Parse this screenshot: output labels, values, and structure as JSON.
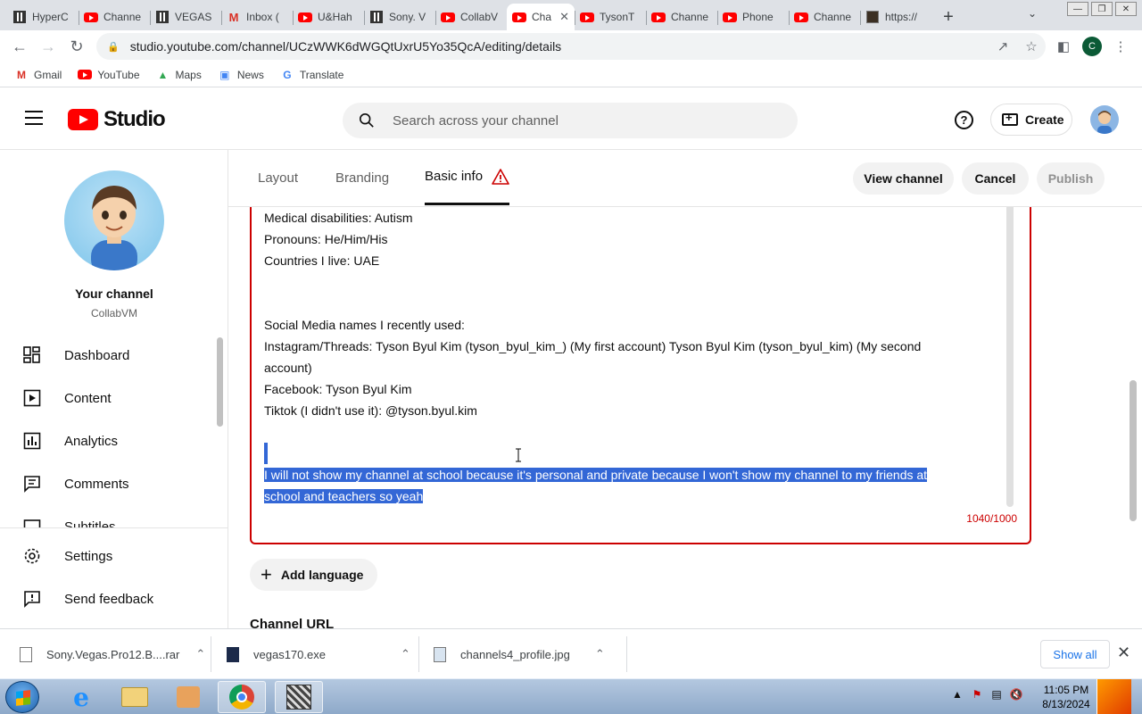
{
  "browser": {
    "tabs": [
      {
        "title": "HyperC",
        "icon": "box"
      },
      {
        "title": "Channe",
        "icon": "youtube"
      },
      {
        "title": "VEGAS",
        "icon": "box"
      },
      {
        "title": "Inbox (",
        "icon": "gmail"
      },
      {
        "title": "U&Hah",
        "icon": "youtube"
      },
      {
        "title": "Sony. V",
        "icon": "box"
      },
      {
        "title": "CollabV",
        "icon": "youtube"
      },
      {
        "title": "Cha",
        "icon": "youtube",
        "active": true
      },
      {
        "title": "TysonT",
        "icon": "youtube"
      },
      {
        "title": "Channe",
        "icon": "youtube"
      },
      {
        "title": "Phone",
        "icon": "youtube"
      },
      {
        "title": "Channe",
        "icon": "youtube"
      },
      {
        "title": "https://",
        "icon": "dark"
      }
    ],
    "url": "studio.youtube.com/channel/UCzWWK6dWGQtUxrU5Yo35QcA/editing/details",
    "profile_initial": "C",
    "bookmarks": [
      {
        "label": "Gmail",
        "icon": "gmail-icon"
      },
      {
        "label": "YouTube",
        "icon": "youtube-icon"
      },
      {
        "label": "Maps",
        "icon": "maps-icon"
      },
      {
        "label": "News",
        "icon": "news-icon"
      },
      {
        "label": "Translate",
        "icon": "translate-icon"
      }
    ]
  },
  "studio": {
    "logo_text": "Studio",
    "search_placeholder": "Search across your channel",
    "create_label": "Create",
    "help_glyph": "?"
  },
  "sidebar": {
    "your_channel": "Your channel",
    "channel_name": "CollabVM",
    "nav": [
      {
        "label": "Dashboard",
        "icon": "dashboard-icon"
      },
      {
        "label": "Content",
        "icon": "content-icon"
      },
      {
        "label": "Analytics",
        "icon": "analytics-icon"
      },
      {
        "label": "Comments",
        "icon": "comments-icon"
      },
      {
        "label": "Subtitles",
        "icon": "subtitles-icon"
      }
    ],
    "bottom": [
      {
        "label": "Settings",
        "icon": "gear-icon"
      },
      {
        "label": "Send feedback",
        "icon": "feedback-icon"
      }
    ]
  },
  "main": {
    "tabs": [
      {
        "label": "Layout"
      },
      {
        "label": "Branding"
      },
      {
        "label": "Basic info",
        "active": true,
        "warning": true
      }
    ],
    "buttons": {
      "view_channel": "View channel",
      "cancel": "Cancel",
      "publish": "Publish"
    },
    "description_lines": [
      "Medical disabilities: Autism",
      "Pronouns: He/Him/His",
      "Countries I live: UAE",
      "",
      "",
      "Social Media names I recently used:",
      "Instagram/Threads: Tyson Byul Kim (tyson_byul_kim_) (My first account) Tyson Byul Kim (tyson_byul_kim) (My second",
      "account)",
      "Facebook: Tyson Byul Kim",
      "Tiktok (I didn't use it): @tyson.byul.kim",
      ""
    ],
    "selected_lines": [
      "I will not show my channel at school because it's personal and private because I won't show my channel to my friends at",
      "school and teachers so yeah"
    ],
    "char_count": "1040/1000",
    "add_language": "Add language",
    "channel_url_heading": "Channel URL"
  },
  "downloads": {
    "items": [
      {
        "name": "Sony.Vegas.Pro12.B....rar"
      },
      {
        "name": "vegas170.exe"
      },
      {
        "name": "channels4_profile.jpg"
      }
    ],
    "show_all": "Show all"
  },
  "taskbar": {
    "time": "11:05 PM",
    "date": "8/13/2024"
  },
  "colors": {
    "error": "#cc0000",
    "selection": "#3367d6",
    "youtube_red": "#ff0000"
  }
}
